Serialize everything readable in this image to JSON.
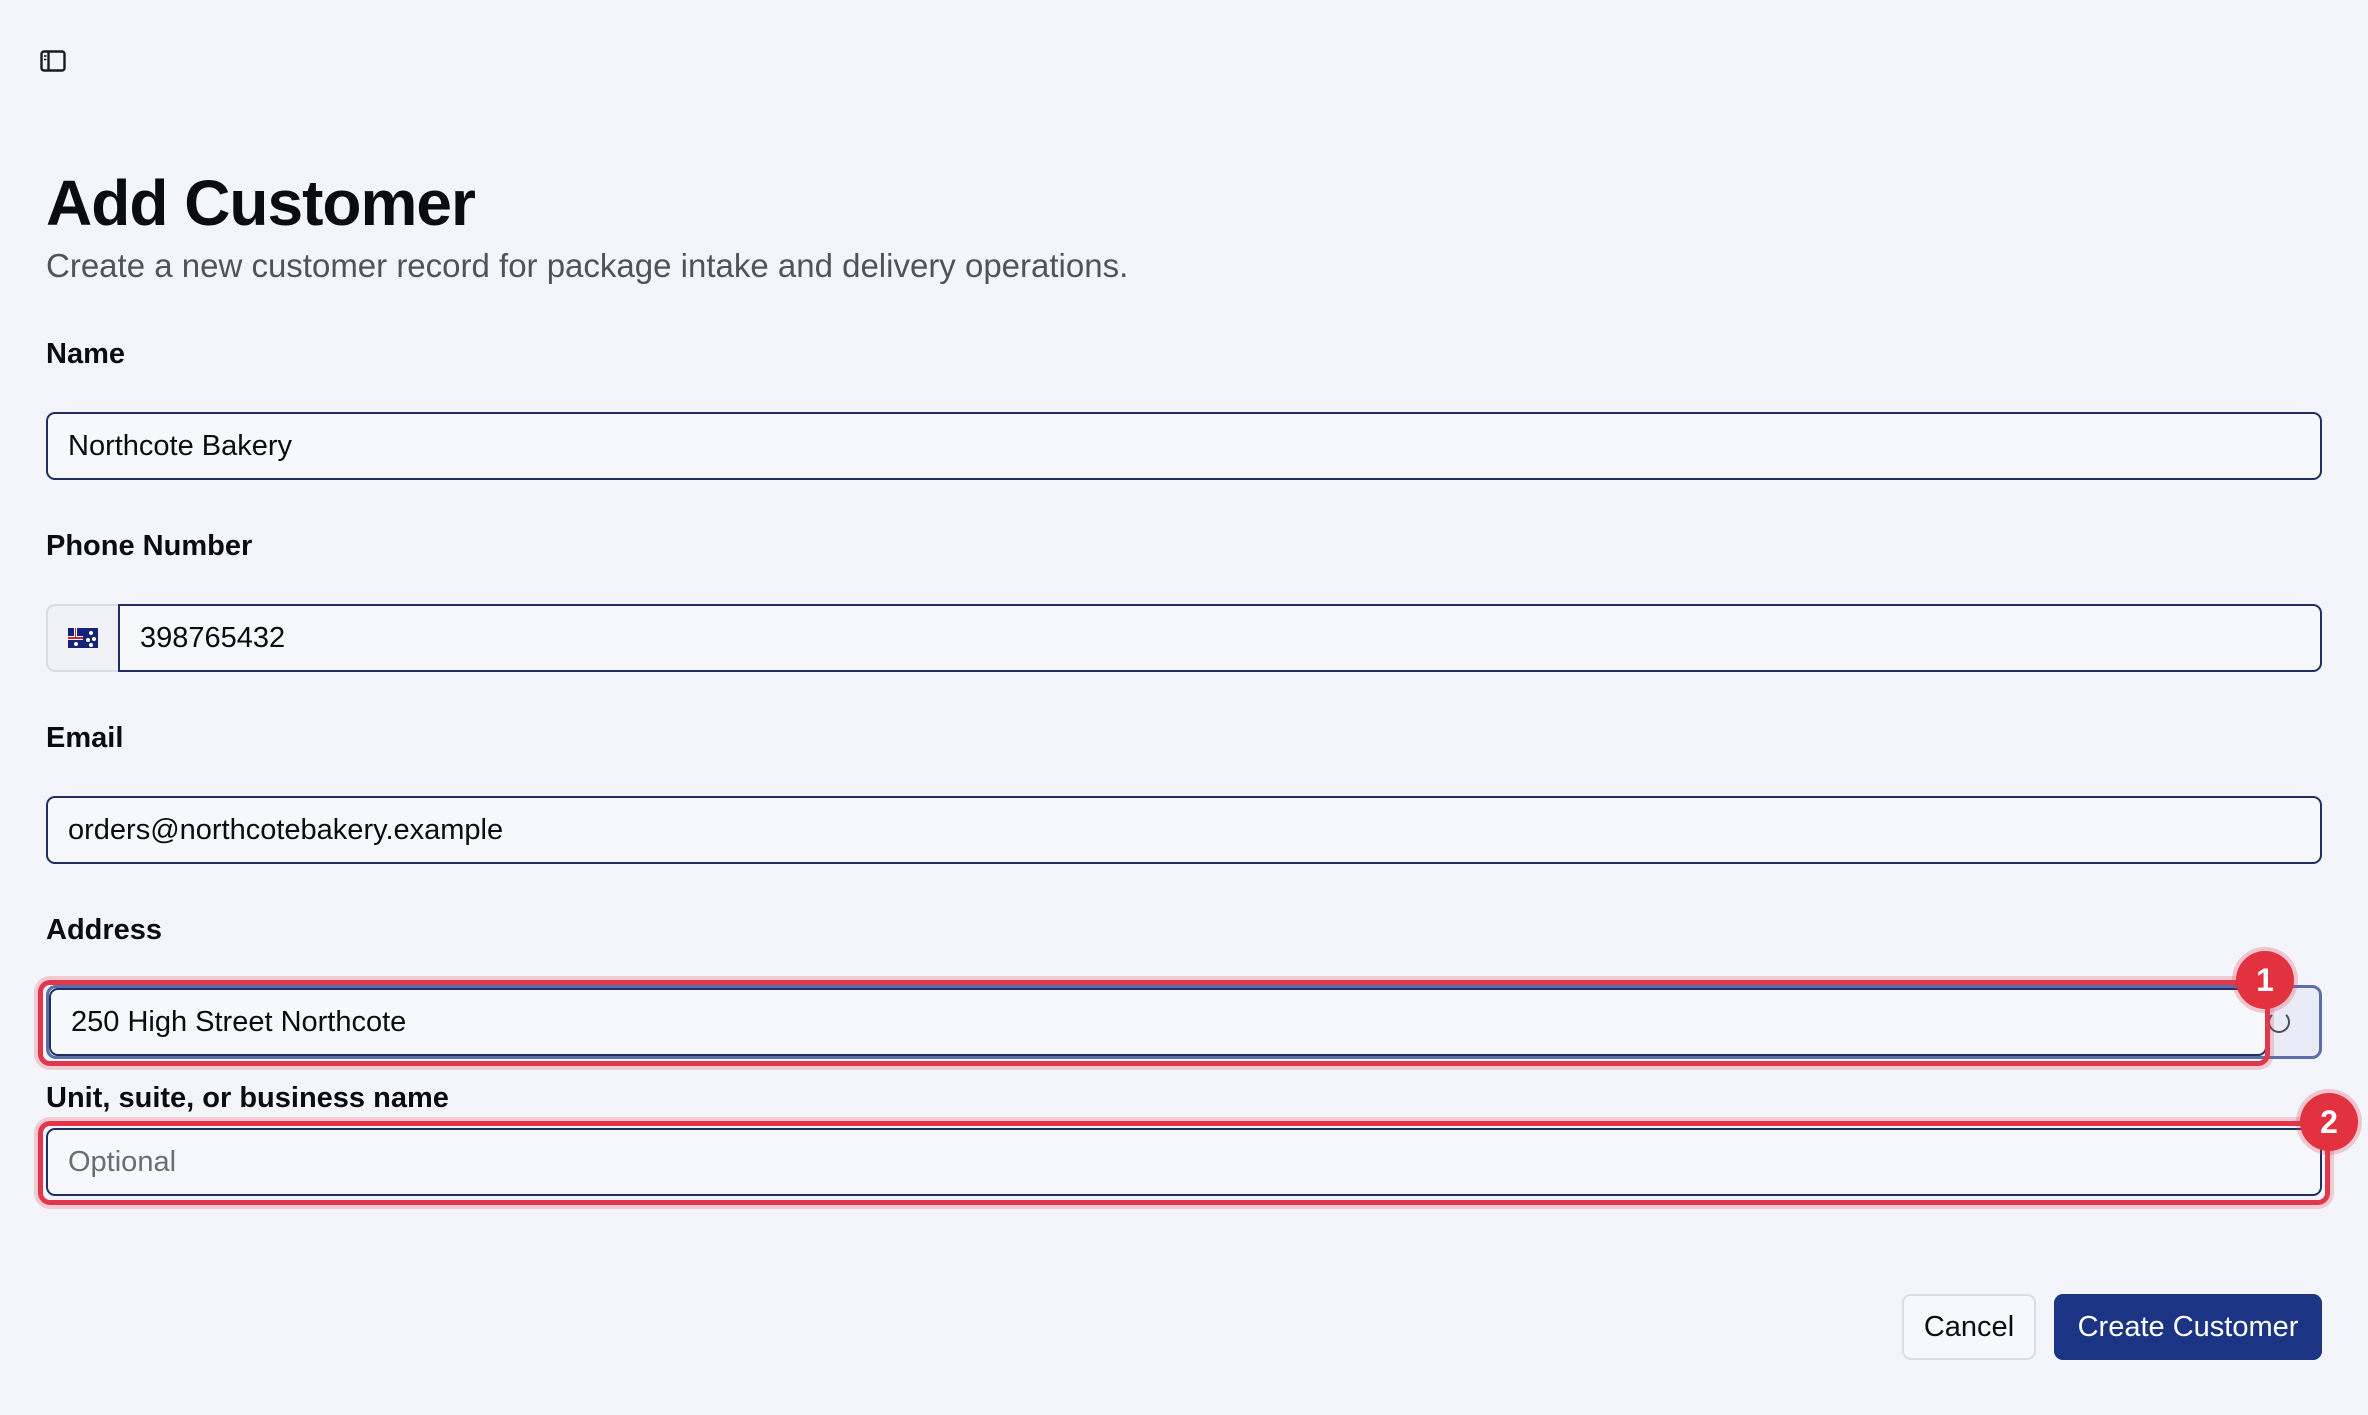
{
  "header": {
    "sidebar_toggle_icon": "sidebar-panel-icon"
  },
  "page": {
    "title": "Add Customer",
    "subtitle": "Create a new customer record for package intake and delivery operations."
  },
  "form": {
    "name": {
      "label": "Name",
      "value": "Northcote Bakery"
    },
    "phone": {
      "label": "Phone Number",
      "country_flag_icon": "australia-flag-icon",
      "value": "398765432"
    },
    "email": {
      "label": "Email",
      "value": "orders@northcotebakery.example"
    },
    "address": {
      "label": "Address",
      "value": "250 High Street Northcote",
      "status_icon": "loading-spinner-icon"
    },
    "unit": {
      "label": "Unit, suite, or business name",
      "value": "",
      "placeholder": "Optional"
    }
  },
  "annotations": {
    "marker_1": "1",
    "marker_2": "2",
    "highlight_color": "#e2364a"
  },
  "actions": {
    "cancel_label": "Cancel",
    "submit_label": "Create Customer",
    "primary_color": "#1c3484"
  }
}
